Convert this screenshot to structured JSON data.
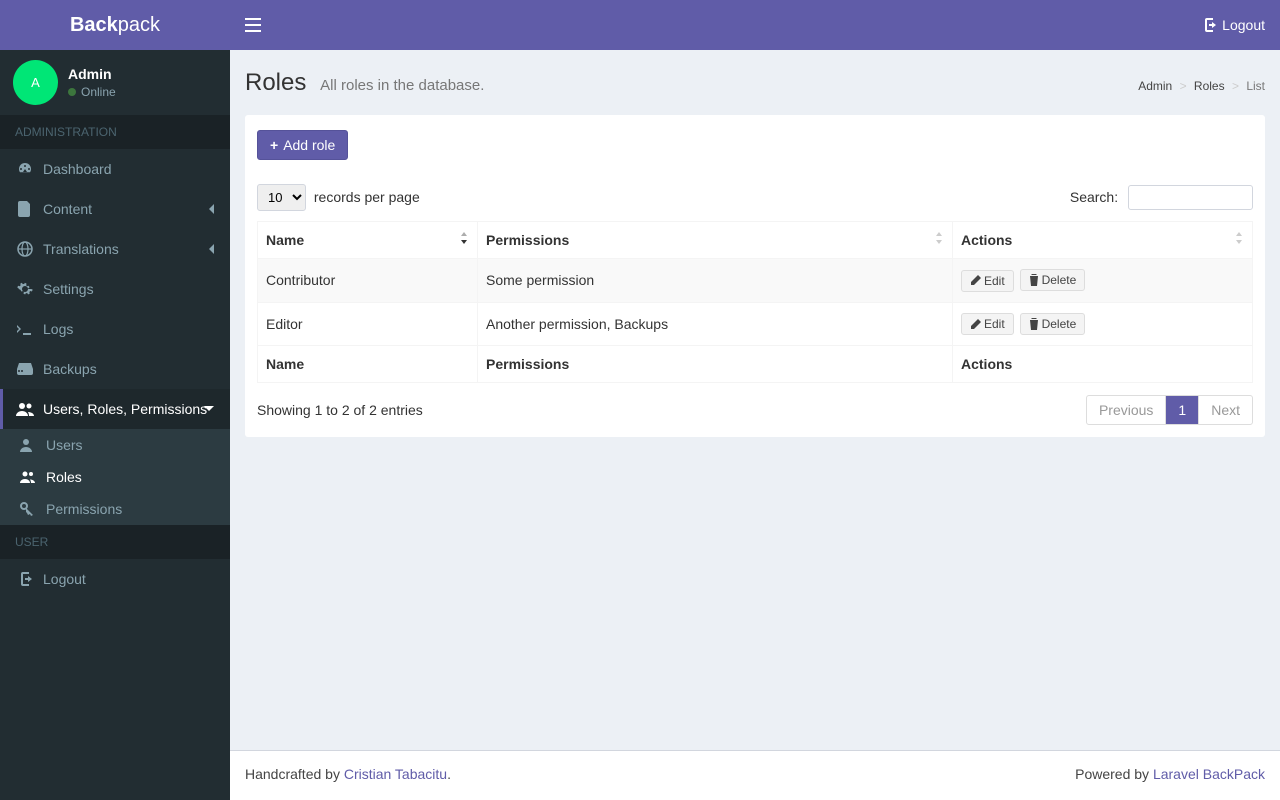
{
  "brand": {
    "bold": "Back",
    "rest": "pack"
  },
  "user": {
    "initial": "A",
    "name": "Admin",
    "status": "Online"
  },
  "sidebar": {
    "section_admin": "ADMINISTRATION",
    "section_user": "USER",
    "items": {
      "dashboard": "Dashboard",
      "content": "Content",
      "translations": "Translations",
      "settings": "Settings",
      "logs": "Logs",
      "backups": "Backups",
      "urp": "Users, Roles, Permissions",
      "users": "Users",
      "roles": "Roles",
      "permissions": "Permissions",
      "logout": "Logout"
    }
  },
  "header": {
    "logout": "Logout"
  },
  "page": {
    "title": "Roles",
    "subtitle": "All roles in the database."
  },
  "breadcrumb": {
    "admin": "Admin",
    "roles": "Roles",
    "list": "List"
  },
  "toolbar": {
    "add_role": "Add role"
  },
  "dt": {
    "length_value": "10",
    "records_per_page": "records per page",
    "search_label": "Search:",
    "search_value": "",
    "cols": {
      "name": "Name",
      "permissions": "Permissions",
      "actions": "Actions"
    },
    "rows": [
      {
        "name": "Contributor",
        "permissions": "Some permission"
      },
      {
        "name": "Editor",
        "permissions": "Another permission, Backups"
      }
    ],
    "edit": "Edit",
    "delete": "Delete",
    "info": "Showing 1 to 2 of 2 entries",
    "prev": "Previous",
    "next": "Next",
    "page1": "1"
  },
  "footer": {
    "handcrafted": "Handcrafted by ",
    "author": "Cristian Tabacitu",
    "powered": "Powered by ",
    "product": "Laravel BackPack"
  }
}
